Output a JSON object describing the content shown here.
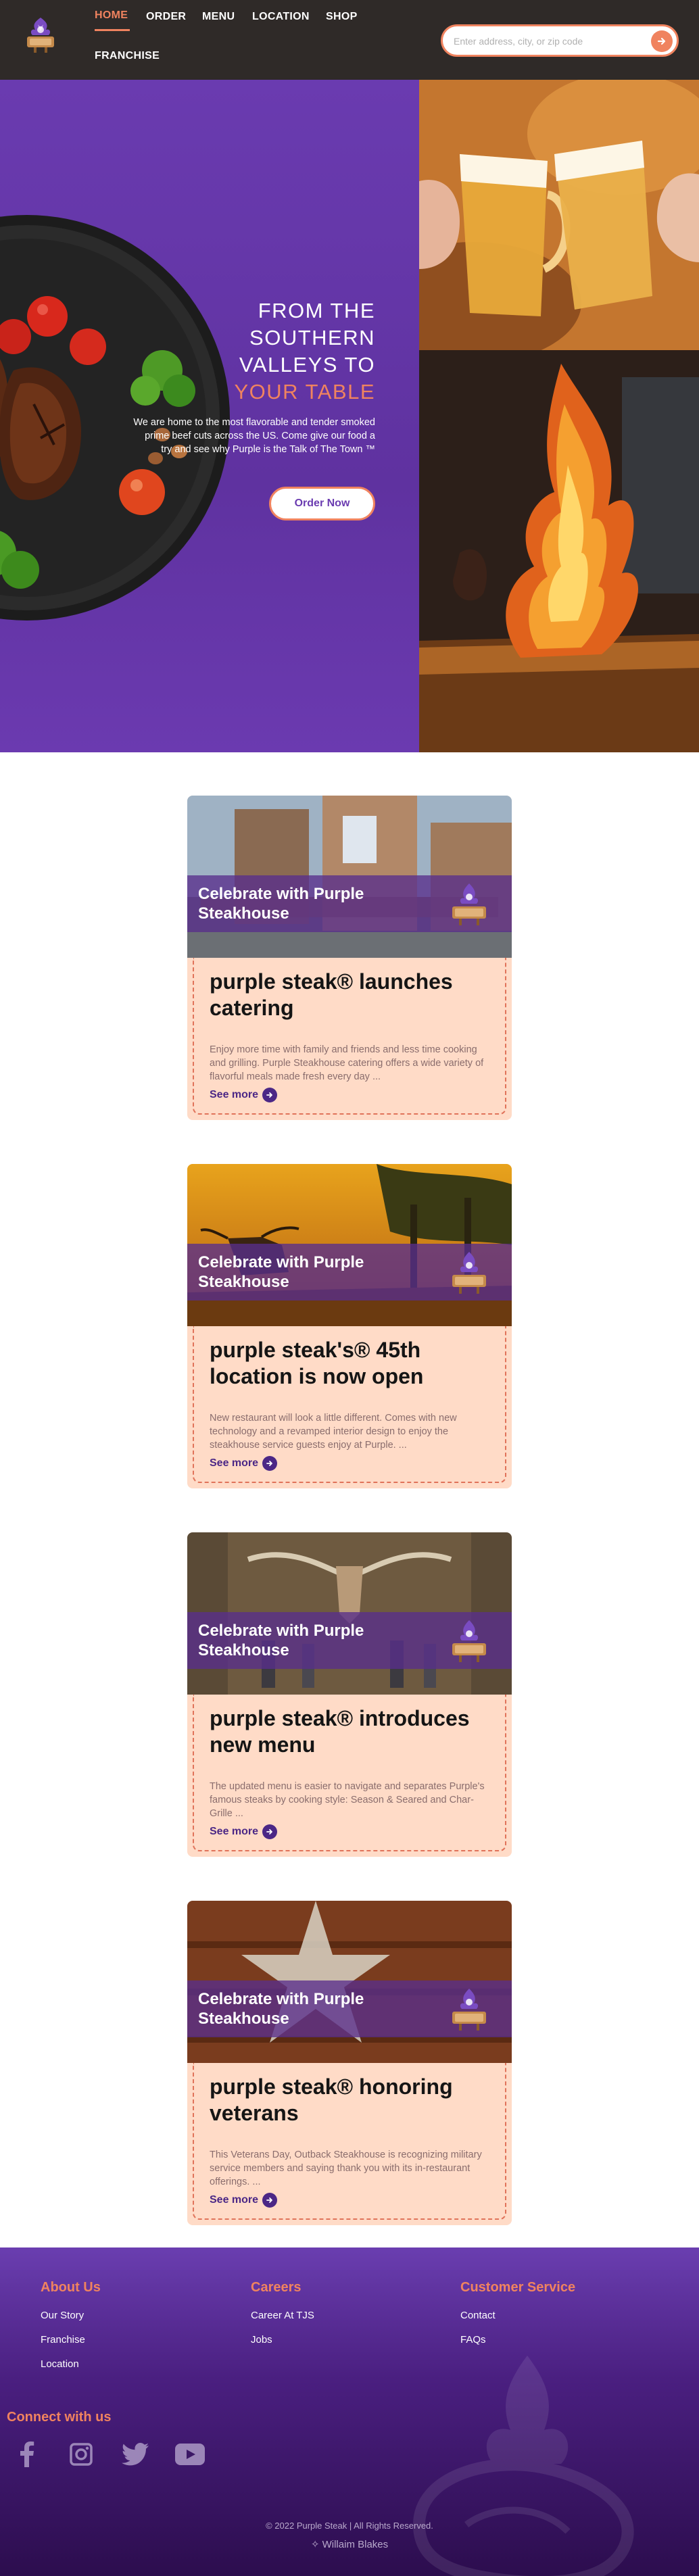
{
  "nav": {
    "items": [
      "HOME",
      "ORDER",
      "MENU",
      "LOCATION",
      "SHOP",
      "FRANCHISE"
    ],
    "active": "HOME"
  },
  "search": {
    "placeholder": "Enter address, city, or zip code"
  },
  "hero": {
    "title_lines": [
      "FROM THE",
      "SOUTHERN",
      "VALLEYS TO"
    ],
    "title_accent": "YOUR TABLE",
    "text": "We are home to the most flavorable and tender smoked prime beef cuts across the US. Come give our food a try and see why Purple is the Talk of The Town ™",
    "cta": "Order Now"
  },
  "cards": [
    {
      "band": "Celebrate with Purple Steakhouse",
      "title": "purple steak® launches catering",
      "text": "Enjoy more time with family and friends and less time cooking and grilling. Purple Steakhouse catering offers a wide variety of flavorful meals made fresh every day ...",
      "link": "See more"
    },
    {
      "band": "Celebrate with Purple Steakhouse",
      "title": "purple steak's® 45th location is now open",
      "text": "New restaurant will look a little different. Comes with new technology and a revamped interior design to enjoy the steakhouse service guests enjoy at Purple. ...",
      "link": "See more"
    },
    {
      "band": "Celebrate with Purple Steakhouse",
      "title": "purple steak® introduces new menu",
      "text": "The updated menu is easier to navigate and separates Purple's famous steaks by cooking style: Season & Seared and Char-Grille ...",
      "link": "See more"
    },
    {
      "band": "Celebrate with Purple Steakhouse",
      "title": "purple steak® honoring veterans",
      "text": "This Veterans Day, Outback Steakhouse is recognizing military service members and saying thank you with its in-restaurant offerings. ...",
      "link": "See more"
    }
  ],
  "footer": {
    "columns": [
      {
        "heading": "About Us",
        "links": [
          "Our Story",
          "Franchise",
          "Location"
        ]
      },
      {
        "heading": "Careers",
        "links": [
          "Career At TJS",
          "Jobs"
        ]
      },
      {
        "heading": "Customer Service",
        "links": [
          "Contact",
          "FAQs"
        ]
      }
    ],
    "connect": "Connect with us",
    "social": [
      "facebook-icon",
      "instagram-icon",
      "twitter-icon",
      "youtube-icon"
    ],
    "copyright": "© 2022 Purple Steak | All Rights Reserved.",
    "credit": "Willaim Blakes"
  },
  "colors": {
    "accent": "#f0835f",
    "brand_purple": "#6a3bb0",
    "header_bg": "#2f2a28",
    "card_bg": "#ffdbc7"
  }
}
